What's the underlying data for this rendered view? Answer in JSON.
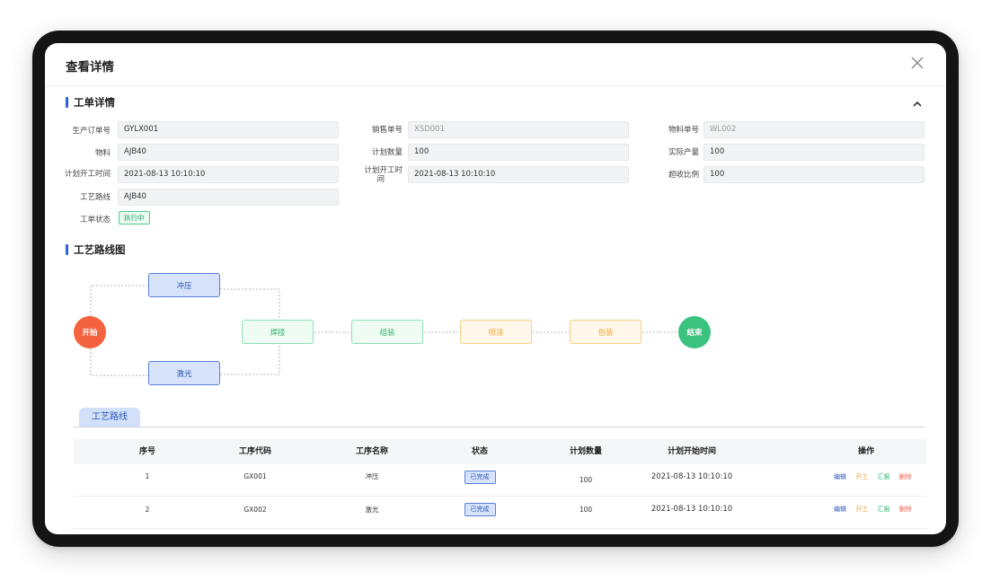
{
  "modal": {
    "title": "查看详情"
  },
  "work_order": {
    "section_title": "工单详情",
    "fields": {
      "prod_order_no": {
        "label": "生产订单号",
        "value": "GYLX001"
      },
      "sales_no": {
        "label": "销售单号",
        "value": "XSD001"
      },
      "material_no": {
        "label": "物料单号",
        "value": "WL002"
      },
      "material": {
        "label": "物料",
        "value": "AJB40"
      },
      "plan_qty": {
        "label": "计划数量",
        "value": "100"
      },
      "actual_output": {
        "label": "实际产量",
        "value": "100"
      },
      "plan_start": {
        "label": "计划开工时间",
        "value": "2021-08-13 10:10:10"
      },
      "plan_start2": {
        "label_line1": "计划开工时",
        "label_line2": "间",
        "value": "2021-08-13 10:10:10"
      },
      "overrun_ratio": {
        "label": "超收比例",
        "value": "100"
      },
      "route": {
        "label": "工艺路线",
        "value": "AJB40"
      },
      "status": {
        "label": "工单状态",
        "value": "执行中"
      }
    }
  },
  "route_diagram": {
    "section_title": "工艺路线图",
    "nodes": {
      "start": "开始",
      "stamping": "冲压",
      "laser": "激光",
      "welding": "焊接",
      "assembly": "组装",
      "spraying": "喷涂",
      "packing": "包装",
      "end": "结束"
    },
    "colors": {
      "blue": "#5b7fd6",
      "green": "#3bc27e",
      "orange": "#eda73a",
      "start": "#f4633e"
    }
  },
  "route_table": {
    "tab_label": "工艺路线",
    "headers": [
      "序号",
      "工序代码",
      "工序名称",
      "状态",
      "计划数量",
      "计划开始时间",
      "操作"
    ],
    "rows": [
      {
        "index": "1",
        "code": "GX001",
        "name": "冲压",
        "status": "已完成",
        "qty": "100",
        "time": "2021-08-13 10:10:10"
      },
      {
        "index": "2",
        "code": "GX002",
        "name": "激光",
        "status": "已完成",
        "qty": "100",
        "time": "2021-08-13 10:10:10"
      }
    ],
    "actions": {
      "edit": "编辑",
      "start": "开工",
      "report": "汇报",
      "delete": "删除"
    }
  }
}
